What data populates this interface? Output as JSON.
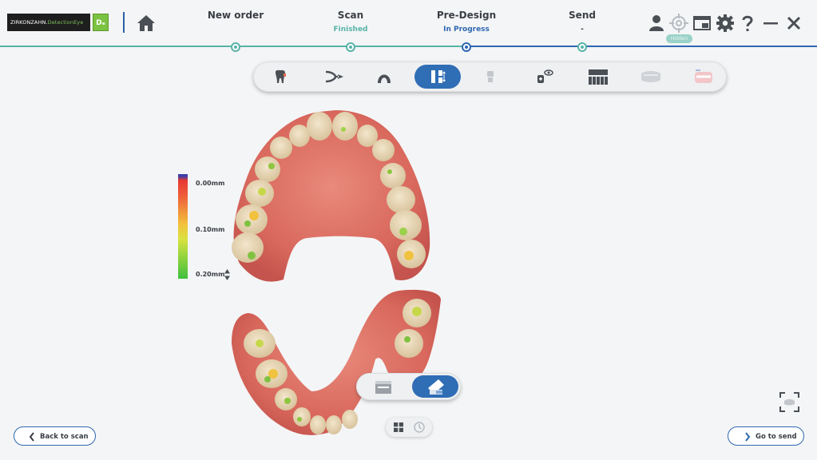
{
  "header": {
    "logo_text_main": "ZIRKONZAHN.",
    "logo_text_sub": "DetectionEye",
    "logo_badge": "Dₑ",
    "home_icon": "home-icon"
  },
  "steps": [
    {
      "name": "New order",
      "status": "",
      "status_color": "#57b3a8"
    },
    {
      "name": "Scan",
      "status": "Finished",
      "status_color": "#57b3a8"
    },
    {
      "name": "Pre-Design",
      "status": "In Progress",
      "status_color": "#2e67b1"
    },
    {
      "name": "Send",
      "status": "-",
      "status_color": "#3a3f45"
    }
  ],
  "top_icons": [
    "user-icon",
    "target-icon",
    "window-icon",
    "gear-icon",
    "help-icon",
    "minimize-icon",
    "close-icon"
  ],
  "tooltip": "Hidden",
  "toolbar": {
    "tools": [
      "tooth-icon",
      "bite-icon",
      "arch-icon",
      "align-icon",
      "implant-icon",
      "tooth-view-icon",
      "crown-row-icon",
      "gingiva-icon",
      "denture-icon"
    ],
    "active_index": 3
  },
  "scale": {
    "top": "0.00mm",
    "mid": "0.10mm",
    "bottom": "0.20mm"
  },
  "mode_toggle": {
    "options": [
      "texture-icon",
      "distance-map-icon"
    ],
    "active_index": 1
  },
  "mini_toggle": {
    "options": [
      "grid-icon",
      "history-icon"
    ]
  },
  "buttons": {
    "back": "Back to scan",
    "next": "Go to send"
  },
  "colors": {
    "accent_blue": "#2e67b1",
    "done_teal": "#57b3a8"
  }
}
